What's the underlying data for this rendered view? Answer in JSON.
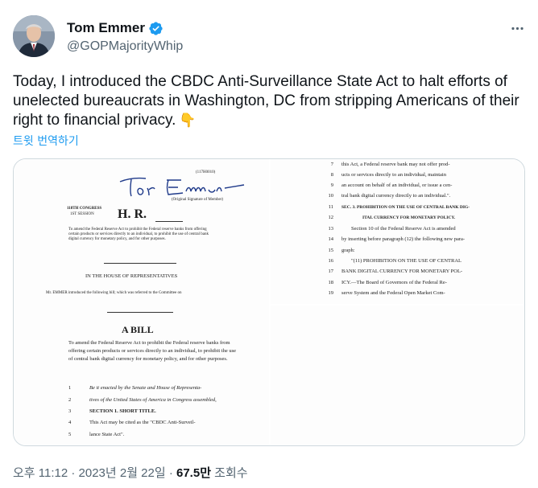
{
  "author": {
    "display_name": "Tom Emmer",
    "handle": "@GOPMajorityWhip",
    "verified": true
  },
  "tweet": {
    "text": "Today, I introduced the CBDC Anti-Surveillance State Act to halt efforts of unelected bureaucrats in Washington, DC from stripping Americans of their right to financial privacy.",
    "emoji": "👇",
    "translate_label": "트윗 번역하기"
  },
  "document": {
    "left_page": {
      "doc_id": "(117H0010)",
      "signature_caption": "(Original Signature of Member)",
      "congress": "118TH CONGRESS",
      "session": "1ST SESSION",
      "bill_type": "H. R.",
      "summary": "To amend the Federal Reserve Act to prohibit the Federal reserve banks from offering certain products or services directly to an individual, to prohibit the use of central bank digital currency for monetary policy, and for other purposes.",
      "house_heading": "IN THE HOUSE OF REPRESENTATIVES",
      "intro_line": "Mr. EMMER introduced the following bill; which was referred to the Committee on",
      "a_bill": "A BILL",
      "bill_purpose": "To amend the Federal Reserve Act to prohibit the Federal reserve banks from offering certain products or services directly to an individual, to prohibit the use of central bank digital currency for monetary policy, and for other purposes.",
      "lines": [
        {
          "num": "1",
          "text": "Be it enacted by the Senate and House of Representa-"
        },
        {
          "num": "2",
          "text": "tives of the United States of America in Congress assembled,"
        },
        {
          "num": "3",
          "text": "SECTION 1. SHORT TITLE."
        },
        {
          "num": "4",
          "text": "This Act may be cited as the \"CBDC Anti-Surveil-"
        },
        {
          "num": "5",
          "text": "lance State Act\"."
        }
      ]
    },
    "right_page": {
      "lines": [
        {
          "num": "7",
          "text": "this Act, a Federal reserve bank may not offer prod-"
        },
        {
          "num": "8",
          "text": "ucts or services directly to an individual, maintain"
        },
        {
          "num": "9",
          "text": "an account on behalf of an individual, or issue a cen-"
        },
        {
          "num": "10",
          "text": "tral bank digital currency directly to an individual.\"."
        },
        {
          "num": "11",
          "text": "SEC. 3. PROHIBITION ON THE USE OF CENTRAL BANK DIG-"
        },
        {
          "num": "12",
          "text": "ITAL CURRENCY FOR MONETARY POLICY."
        },
        {
          "num": "13",
          "text": "Section 10 of the Federal Reserve Act is amended"
        },
        {
          "num": "14",
          "text": "by inserting before paragraph (12) the following new para-"
        },
        {
          "num": "15",
          "text": "graph:"
        },
        {
          "num": "16",
          "text": "\"(11) PROHIBITION ON THE USE OF CENTRAL"
        },
        {
          "num": "17",
          "text": "BANK DIGITAL CURRENCY FOR MONETARY POL-"
        },
        {
          "num": "18",
          "text": "ICY.—The Board of Governors of the Federal Re-"
        },
        {
          "num": "19",
          "text": "serve System and the Federal Open Market Com-"
        }
      ]
    }
  },
  "footer": {
    "timestamp": "오후 11:12 · 2023년 2월 22일",
    "separator": " · ",
    "views_count": "67.5만",
    "views_label": " 조회수"
  },
  "colors": {
    "accent": "#1d9bf0",
    "secondary_text": "#536471",
    "primary_text": "#0f1419",
    "border": "#cfd9de"
  },
  "icons": {
    "verified": "verified-badge-icon",
    "more": "more-options-icon"
  }
}
